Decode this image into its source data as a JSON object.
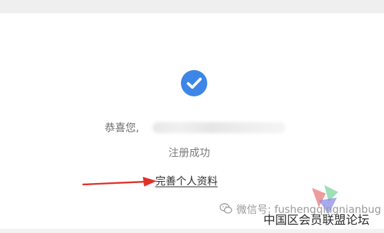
{
  "colors": {
    "check_blue": "#3d85e6",
    "arrow_red": "#e0302a",
    "text_gray": "#6a6a6a",
    "link_dark": "#2e2e2e"
  },
  "icons": {
    "success": "check-circle-icon",
    "arrow": "red-arrow-annotation",
    "wechat": "wechat-icon"
  },
  "main": {
    "greeting_label": "恭喜您,",
    "success_message": "注册成功",
    "complete_profile_link": "完善个人资料"
  },
  "watermark": {
    "wechat_text": "微信号: fushengqingnianbug",
    "forum_text": "中国区会员联盟论坛"
  }
}
